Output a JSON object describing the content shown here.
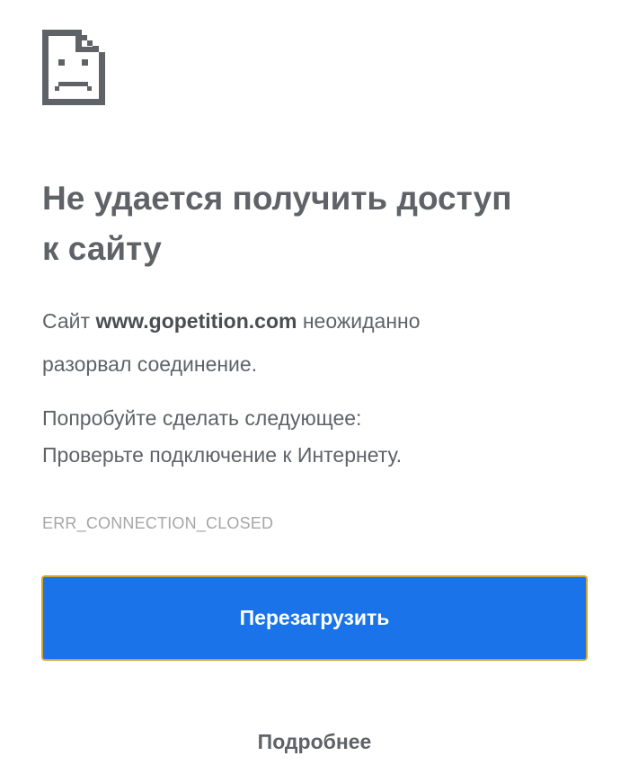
{
  "error_page": {
    "icon": "sad-page-icon",
    "title_line1": "Не удается получить доступ",
    "title_line2": "к сайту",
    "summary_prefix": "Сайт ",
    "summary_host": "www.gopetition.com",
    "summary_suffix_line1": " неожиданно",
    "summary_line2": "разорвал соединение.",
    "suggestions_heading": "Попробуйте сделать следующее:",
    "suggestion_item": "Проверьте подключение к Интернету.",
    "error_code": "ERR_CONNECTION_CLOSED",
    "reload_label": "Перезагрузить",
    "details_label": "Подробнее"
  },
  "colors": {
    "text": "#5f6368",
    "button_bg": "#1a73e8",
    "button_border": "#d4a52a",
    "error_code": "#a6a6a6"
  }
}
